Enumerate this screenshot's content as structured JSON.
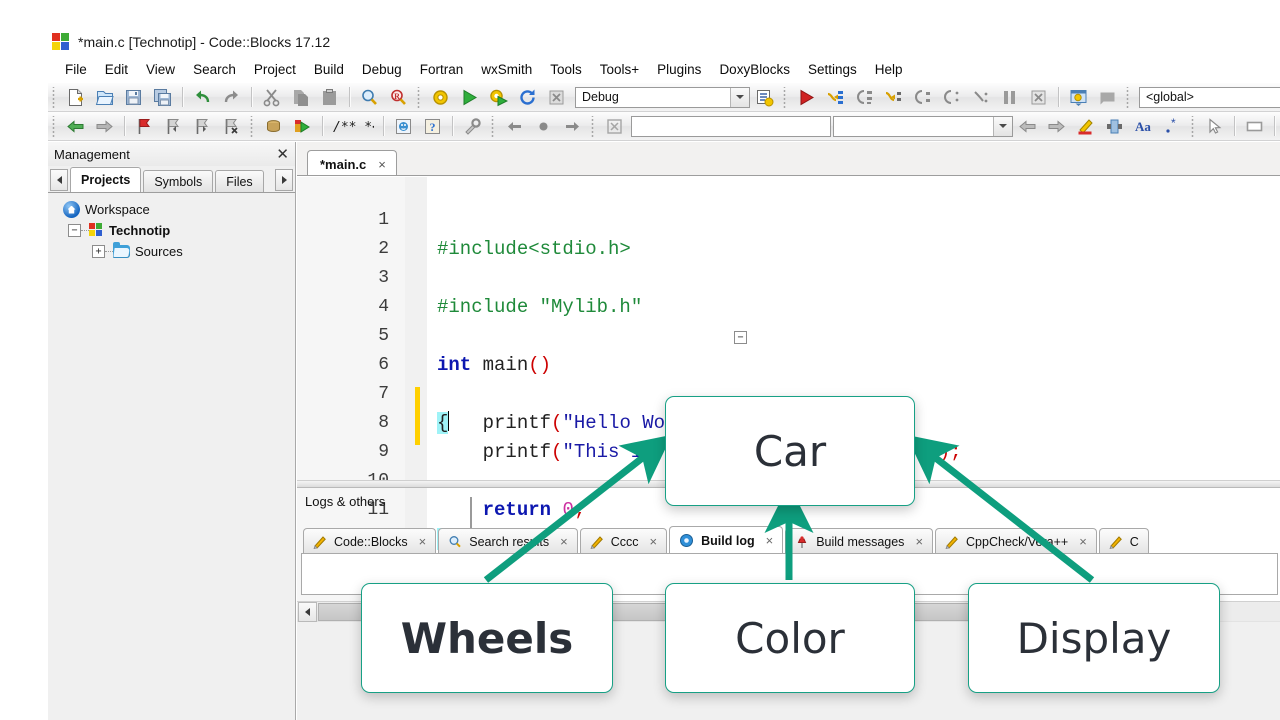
{
  "window": {
    "title": "*main.c [Technotip] - Code::Blocks 17.12",
    "logo_icon": "codeblocks-logo-icon"
  },
  "menubar": {
    "items": [
      {
        "label": "File"
      },
      {
        "label": "Edit"
      },
      {
        "label": "View"
      },
      {
        "label": "Search"
      },
      {
        "label": "Project"
      },
      {
        "label": "Build"
      },
      {
        "label": "Debug"
      },
      {
        "label": "Fortran"
      },
      {
        "label": "wxSmith"
      },
      {
        "label": "Tools"
      },
      {
        "label": "Tools+"
      },
      {
        "label": "Plugins"
      },
      {
        "label": "DoxyBlocks"
      },
      {
        "label": "Settings"
      },
      {
        "label": "Help"
      }
    ]
  },
  "toolbar": {
    "build_target_value": "Debug",
    "scope_value": "<global>",
    "find_value": "",
    "goto_value": ""
  },
  "management": {
    "title": "Management",
    "close_icon": "close-icon",
    "tabs": [
      {
        "label": "Projects",
        "active": true
      },
      {
        "label": "Symbols",
        "active": false
      },
      {
        "label": "Files",
        "active": false
      }
    ],
    "tree": [
      {
        "label": "Workspace",
        "icon": "workspace-icon",
        "depth": 0,
        "bold": false
      },
      {
        "label": "Technotip",
        "icon": "project-icon",
        "depth": 1,
        "bold": true,
        "expander": "−"
      },
      {
        "label": "Sources",
        "icon": "folder-icon",
        "depth": 2,
        "bold": false,
        "expander": "+"
      }
    ]
  },
  "editor": {
    "tab_label": "*main.c",
    "tab_close": "×",
    "lines": [
      {
        "n": "1",
        "text": "#include<stdio.h>"
      },
      {
        "n": "2",
        "text": ""
      },
      {
        "n": "3",
        "text": "#include \"Mylib.h\""
      },
      {
        "n": "4",
        "text": ""
      },
      {
        "n": "5",
        "text": "int main()"
      },
      {
        "n": "6",
        "text": "{"
      },
      {
        "n": "7",
        "text": "    printf(\"Hello World ..\\n\");"
      },
      {
        "n": "8",
        "text": "    printf(\"This is my first C program ..\\n\");"
      },
      {
        "n": "9",
        "text": ""
      },
      {
        "n": "10",
        "text": "    return 0;"
      },
      {
        "n": "11",
        "text": "}"
      }
    ]
  },
  "logs": {
    "title": "Logs & others",
    "tabs": [
      {
        "label": "Code::Blocks",
        "icon": "pencil-icon",
        "active": false,
        "close": "×"
      },
      {
        "label": "Search results",
        "icon": "magnifier-icon",
        "active": false,
        "close": "×"
      },
      {
        "label": "Cccc",
        "icon": "pencil-icon",
        "active": false,
        "close": "×"
      },
      {
        "label": "Build log",
        "icon": "gear-blue-icon",
        "active": true,
        "close": "×"
      },
      {
        "label": "Build messages",
        "icon": "pin-icon",
        "active": false,
        "close": "×"
      },
      {
        "label": "CppCheck/Vera++",
        "icon": "pencil-icon",
        "active": false,
        "close": "×"
      },
      {
        "label": "C",
        "icon": "pencil-icon",
        "active": false,
        "close": "×"
      }
    ]
  },
  "diagram": {
    "accent_color": "#17a085",
    "nodes": [
      {
        "id": "car",
        "label": "Car"
      },
      {
        "id": "wheels",
        "label": "Wheels"
      },
      {
        "id": "color",
        "label": "Color"
      },
      {
        "id": "display",
        "label": "Display"
      }
    ],
    "edges": [
      {
        "from": "wheels",
        "to": "car"
      },
      {
        "from": "color",
        "to": "car"
      },
      {
        "from": "display",
        "to": "car"
      }
    ]
  }
}
